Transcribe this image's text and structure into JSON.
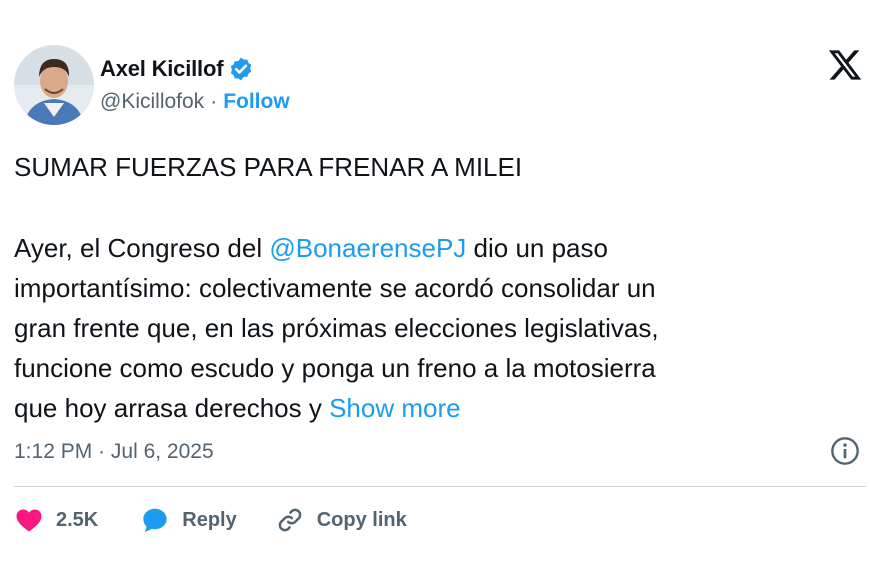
{
  "author": {
    "name": "Axel Kicillof",
    "handle": "@Kicillofok",
    "separator": "·",
    "follow_label": "Follow"
  },
  "tweet": {
    "headline": "SUMAR FUERZAS PARA FRENAR A MILEI",
    "line1_prefix": "Ayer, el Congreso del ",
    "mention": "@BonaerensePJ",
    "line1_suffix": " dio un paso",
    "line2": "importantísimo: colectivamente se acordó consolidar un",
    "line3": "gran frente que, en las próximas elecciones legislativas,",
    "line4": "funcione como escudo y ponga un freno a la motosierra",
    "line5_prefix": "que hoy arrasa derechos y ",
    "show_more": "Show more"
  },
  "timestamp": {
    "time": "1:12 PM",
    "separator": " · ",
    "date": "Jul 6, 2025"
  },
  "actions": {
    "likes": "2.5K",
    "reply_label": "Reply",
    "copy_link_label": "Copy link"
  },
  "colors": {
    "accent": "#1d9bf0",
    "like": "#f91880",
    "secondary_text": "#536471"
  },
  "icons": [
    "avatar",
    "verified-badge-icon",
    "x-logo-icon",
    "info-icon",
    "heart-icon",
    "reply-bubble-icon",
    "link-icon"
  ]
}
